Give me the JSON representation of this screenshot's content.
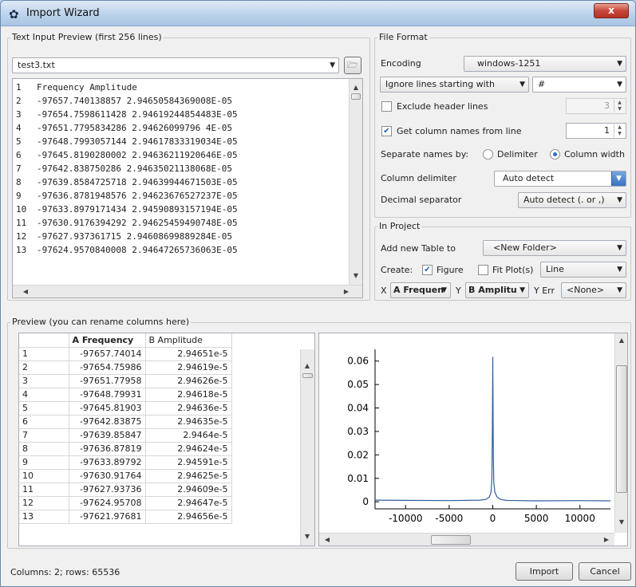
{
  "window": {
    "title": "Import Wizard",
    "close_label": "x"
  },
  "text_input": {
    "group_label": "Text Input Preview (first 256 lines)",
    "file": "test3.txt",
    "lines": [
      {
        "n": "1",
        "text": "Frequency Amplitude"
      },
      {
        "n": "2",
        "text": "-97657.740138857 2.94650584369008E-05"
      },
      {
        "n": "3",
        "text": "-97654.7598611428 2.94619244854483E-05"
      },
      {
        "n": "4",
        "text": "-97651.7795834286 2.94626099796 4E-05"
      },
      {
        "n": "5",
        "text": "-97648.7993057144 2.94617833319034E-05"
      },
      {
        "n": "6",
        "text": "-97645.8190280002 2.94636211920646E-05"
      },
      {
        "n": "7",
        "text": "-97642.838750286 2.94635021138068E-05"
      },
      {
        "n": "8",
        "text": "-97639.8584725718 2.94639944671503E-05"
      },
      {
        "n": "9",
        "text": "-97636.8781948576 2.94623676527237E-05"
      },
      {
        "n": "10",
        "text": "-97633.8979171434 2.94590893157194E-05"
      },
      {
        "n": "11",
        "text": "-97630.9176394292 2.94625459490748E-05"
      },
      {
        "n": "12",
        "text": "-97627.937361715 2.94608699889284E-05"
      },
      {
        "n": "13",
        "text": "-97624.9570840008 2.94647265736063E-05"
      }
    ]
  },
  "file_format": {
    "group_label": "File Format",
    "encoding_label": "Encoding",
    "encoding_value": "windows-1251",
    "ignore_mode": "Ignore lines starting with",
    "ignore_char": "#",
    "exclude_header_label": "Exclude header lines",
    "exclude_header_checked": false,
    "exclude_header_value": "3",
    "get_names_label": "Get column names from line",
    "get_names_checked": true,
    "get_names_value": "1",
    "separate_label": "Separate names by:",
    "delimiter_label": "Delimiter",
    "column_width_label": "Column width",
    "separate_mode": "column_width",
    "column_delim_label": "Column delimiter",
    "column_delim_value": "Auto detect",
    "decimal_label": "Decimal separator",
    "decimal_value": "Auto detect (. or ,)"
  },
  "in_project": {
    "group_label": "In Project",
    "add_table_label": "Add new Table to",
    "add_table_value": "<New Folder>",
    "create_label": "Create:",
    "figure_label": "Figure",
    "figure_checked": true,
    "fit_label": "Fit Plot(s)",
    "fit_checked": false,
    "plot_type": "Line",
    "x_label": "X",
    "x_value": "A Frequen",
    "y_label": "Y",
    "y_value": "B Amplitu",
    "yerr_label": "Y Err",
    "yerr_value": "<None>"
  },
  "preview": {
    "group_label": "Preview (you can rename columns here)",
    "col_a": "A Frequency",
    "col_b": "B Amplitude",
    "rows": [
      [
        "1",
        "-97657.74014",
        "2.94651e-5"
      ],
      [
        "2",
        "-97654.75986",
        "2.94619e-5"
      ],
      [
        "3",
        "-97651.77958",
        "2.94626e-5"
      ],
      [
        "4",
        "-97648.79931",
        "2.94618e-5"
      ],
      [
        "5",
        "-97645.81903",
        "2.94636e-5"
      ],
      [
        "6",
        "-97642.83875",
        "2.94635e-5"
      ],
      [
        "7",
        "-97639.85847",
        "2.9464e-5"
      ],
      [
        "8",
        "-97636.87819",
        "2.94624e-5"
      ],
      [
        "9",
        "-97633.89792",
        "2.94591e-5"
      ],
      [
        "10",
        "-97630.91764",
        "2.94625e-5"
      ],
      [
        "11",
        "-97627.93736",
        "2.94609e-5"
      ],
      [
        "12",
        "-97624.95708",
        "2.94647e-5"
      ],
      [
        "13",
        "-97621.97681",
        "2.94656e-5"
      ]
    ]
  },
  "chart_data": {
    "type": "line",
    "title": "",
    "xlabel": "",
    "ylabel": "",
    "xlim": [
      -13500,
      13500
    ],
    "ylim": [
      -0.003,
      0.065
    ],
    "xticks": [
      -10000,
      -5000,
      0,
      5000,
      10000
    ],
    "yticks": [
      0,
      0.01,
      0.02,
      0.03,
      0.04,
      0.05,
      0.06
    ],
    "series": [
      {
        "color": "#2f5f9e",
        "x": [
          -13500,
          -10000,
          -5000,
          -1500,
          -800,
          -400,
          -200,
          -100,
          -50,
          0,
          30,
          60,
          120,
          250,
          500,
          900,
          1500,
          5000,
          10000,
          13500
        ],
        "y": [
          0.0007,
          0.0006,
          0.0005,
          0.0007,
          0.001,
          0.002,
          0.004,
          0.01,
          0.03,
          0.0618,
          0.045,
          0.02,
          0.008,
          0.004,
          0.002,
          0.001,
          0.0006,
          0.0004,
          0.0005,
          0.0004
        ]
      }
    ]
  },
  "status": {
    "text": "Columns: 2; rows: 65536",
    "import_label": "Import",
    "cancel_label": "Cancel"
  }
}
